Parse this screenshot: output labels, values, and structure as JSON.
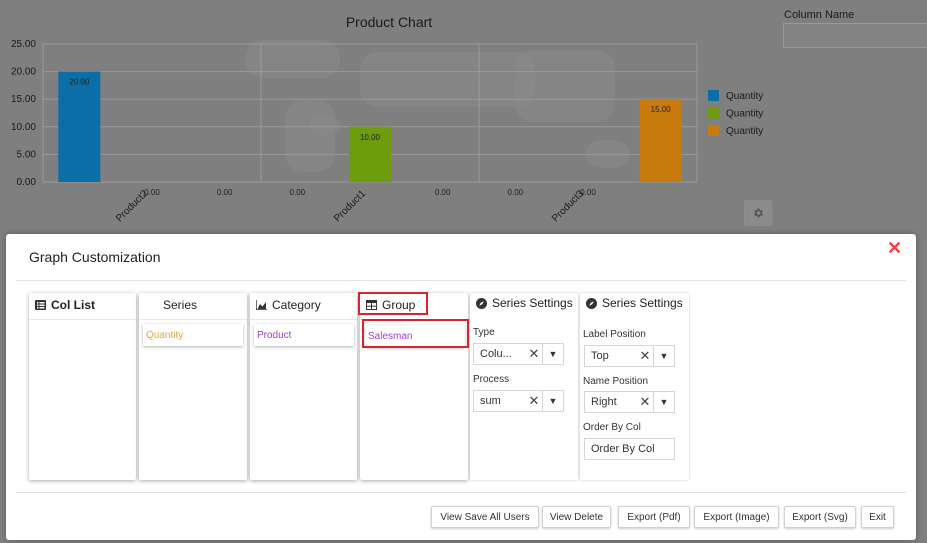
{
  "chart": {
    "title": "Product Chart",
    "column_name_label": "Column Name",
    "column_name_value": ""
  },
  "chart_data": {
    "type": "bar",
    "categories": [
      "Product2",
      "Product1",
      "Product3"
    ],
    "y_ticks": [
      "25.00",
      "20.00",
      "15.00",
      "10.00",
      "5.00",
      "0.00"
    ],
    "ylim": [
      0,
      25
    ],
    "grid": true,
    "legend_position": "right",
    "series": [
      {
        "name": "Quantity",
        "color": "#0b6ea6",
        "values": [
          20,
          0,
          0
        ],
        "labels": [
          "20.00",
          "0.00",
          "0.00"
        ]
      },
      {
        "name": "Quantity",
        "color": "#6d9d0c",
        "values": [
          0,
          10,
          0
        ],
        "labels": [
          "0.00",
          "10.00",
          "0.00"
        ]
      },
      {
        "name": "Quantity",
        "color": "#c97a0d",
        "values": [
          0,
          0,
          15
        ],
        "labels": [
          "0.00",
          "0.00",
          "15.00"
        ]
      }
    ]
  },
  "dialog": {
    "title": "Graph Customization",
    "close_glyph": "✕",
    "columns": [
      {
        "key": "col-list",
        "label": "Col List",
        "icon": "list-icon",
        "chips": []
      },
      {
        "key": "series",
        "label": "Series",
        "icon": "",
        "chips": [
          {
            "text": "Quantity",
            "color": "#e8a33a"
          }
        ]
      },
      {
        "key": "category",
        "label": "Category",
        "icon": "area-chart-icon",
        "chips": [
          {
            "text": "Product",
            "color": "#a03dd6"
          }
        ]
      },
      {
        "key": "group",
        "label": "Group",
        "icon": "table-icon",
        "chips": [
          {
            "text": "Salesman",
            "color": "#a03dd6"
          }
        ]
      }
    ],
    "series_settings_1": {
      "title": "Series Settings",
      "type_label": "Type",
      "type_value": "Colu...",
      "process_label": "Process",
      "process_value": "sum"
    },
    "series_settings_2": {
      "title": "Series Settings",
      "label_position_label": "Label Position",
      "label_position_value": "Top",
      "name_position_label": "Name Position",
      "name_position_value": "Right",
      "order_by_label": "Order By Col",
      "order_by_value": "Order By Col"
    },
    "buttons": {
      "view_save_all": "View Save All Users",
      "view_delete": "View Delete",
      "export_pdf": "Export (Pdf)",
      "export_image": "Export (Image)",
      "export_svg": "Export (Svg)",
      "exit": "Exit"
    },
    "combo_clear": "✕",
    "combo_arrow": "▼"
  }
}
